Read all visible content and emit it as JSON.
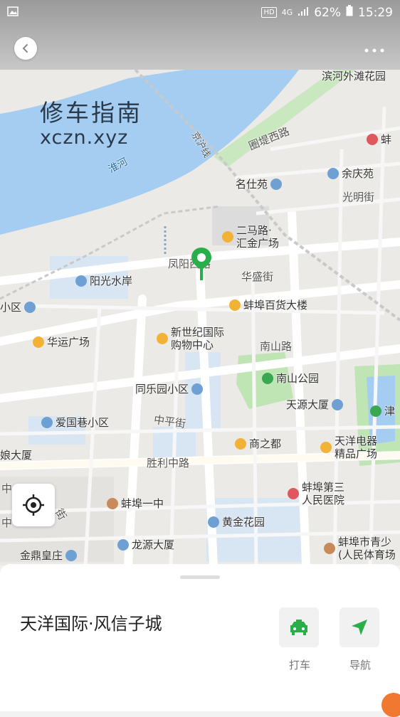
{
  "status_bar": {
    "hd": "HD",
    "network": "4G",
    "battery": "62%",
    "time": "15:29"
  },
  "watermark": {
    "line1": "修车指南",
    "line2": "xczn.xyz"
  },
  "map": {
    "water_label": "淮河",
    "rail_label": "京沪线",
    "pois": [
      {
        "name": "滨河外滩花园",
        "icon": "none"
      },
      {
        "name": "蚌",
        "icon": "hospital-icon"
      },
      {
        "name": "余庆苑",
        "icon": "residential-icon"
      },
      {
        "name": "名仕苑",
        "icon": "residential-icon"
      },
      {
        "name": "二马路·\n汇金广场",
        "icon": "shopping-icon"
      },
      {
        "name": "阳光水岸",
        "icon": "residential-icon"
      },
      {
        "name": "蚌埠百货大楼",
        "icon": "shopping-icon"
      },
      {
        "name": "小区",
        "icon": "residential-icon"
      },
      {
        "name": "华运广场",
        "icon": "shopping-icon"
      },
      {
        "name": "新世纪国际\n购物中心",
        "icon": "shopping-icon"
      },
      {
        "name": "南山公园",
        "icon": "park-icon"
      },
      {
        "name": "同乐园小区",
        "icon": "residential-icon"
      },
      {
        "name": "天源大厦",
        "icon": "building-icon"
      },
      {
        "name": "津",
        "icon": "park-icon"
      },
      {
        "name": "爱国巷小区",
        "icon": "residential-icon"
      },
      {
        "name": "商之都",
        "icon": "shopping-icon"
      },
      {
        "name": "天洋电器\n精品广场",
        "icon": "shopping-icon"
      },
      {
        "name": "娘大厦",
        "icon": "none"
      },
      {
        "name": "蚌埠第三\n人民医院",
        "icon": "hospital-icon"
      },
      {
        "name": "蚌埠一中",
        "icon": "school-icon"
      },
      {
        "name": "黄金花园",
        "icon": "residential-icon"
      },
      {
        "name": "龙源大厦",
        "icon": "building-icon"
      },
      {
        "name": "金鼎皇庄",
        "icon": "residential-icon"
      },
      {
        "name": "蚌埠市青少\n(人民体育场",
        "icon": "sports-icon"
      }
    ],
    "roads": [
      "圈堤西路",
      "光明街",
      "凤阳西路",
      "华盛街",
      "南山路",
      "中平街",
      "胜利中路",
      "中",
      "中",
      "街"
    ]
  },
  "place_sheet": {
    "name": "天洋国际·风信子城",
    "actions": [
      {
        "label": "打车",
        "icon": "taxi-icon",
        "color": "#2aae4a"
      },
      {
        "label": "导航",
        "icon": "navigate-icon",
        "color": "#2aae4a"
      }
    ]
  },
  "colors": {
    "accent": "#2aae4a",
    "water": "#a4cdf1",
    "park": "#bfe5b4",
    "badge": "#f07830"
  }
}
